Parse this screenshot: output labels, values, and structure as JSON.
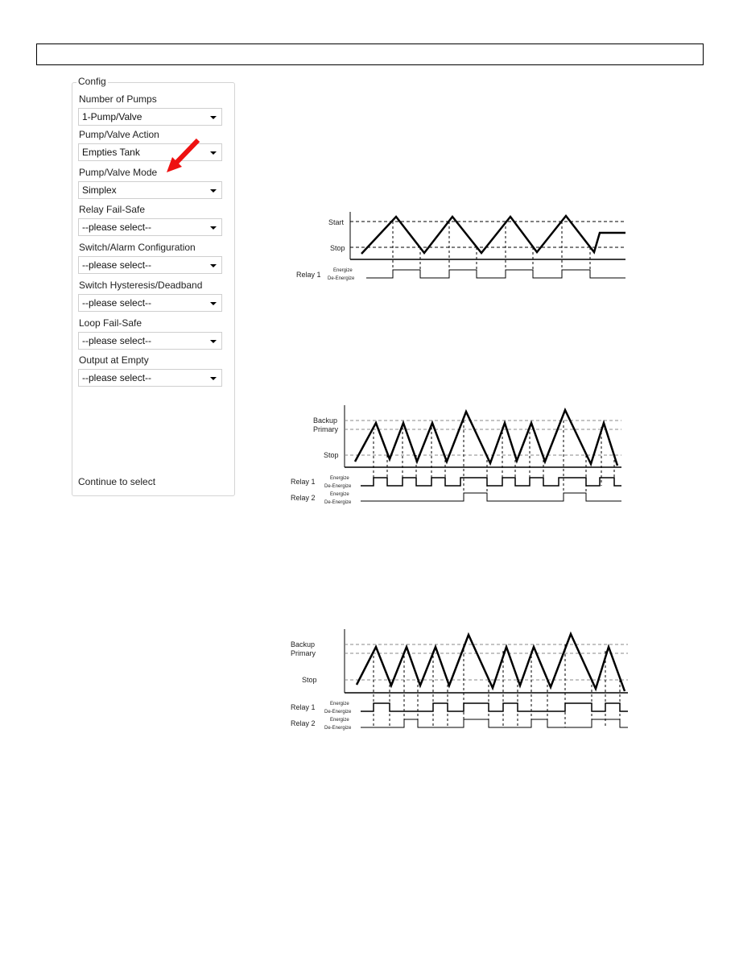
{
  "config": {
    "title": "Config",
    "fields": [
      {
        "label": "Number of Pumps",
        "value": "1-Pump/Valve"
      },
      {
        "label": "Pump/Valve Action",
        "value": "Empties Tank"
      },
      {
        "label": "Pump/Valve Mode",
        "value": "Simplex"
      },
      {
        "label": "Relay Fail-Safe",
        "value": "--please select--"
      },
      {
        "label": "Switch/Alarm Configuration",
        "value": "--please select--"
      },
      {
        "label": "Switch Hysteresis/Deadband",
        "value": "--please select--"
      },
      {
        "label": "Loop Fail-Safe",
        "value": "--please select--"
      },
      {
        "label": "Output at Empty",
        "value": "--please select--"
      }
    ],
    "footer": "Continue to select",
    "arrow_color": "#ee1111"
  },
  "diagram1": {
    "start": "Start",
    "stop": "Stop",
    "relay1": "Relay 1",
    "energize": "Energize",
    "deenergize": "De-Energize"
  },
  "diagram2": {
    "backup": "Backup",
    "primary": "Primary",
    "stop": "Stop",
    "relay1": "Relay 1",
    "relay2": "Relay 2",
    "energize": "Energize",
    "deenergize": "De-Energize"
  },
  "diagram3": {
    "backup": "Backup",
    "primary": "Primary",
    "stop": "Stop",
    "relay1": "Relay 1",
    "relay2": "Relay 2",
    "energize": "Energize",
    "deenergize": "De-Energize"
  }
}
